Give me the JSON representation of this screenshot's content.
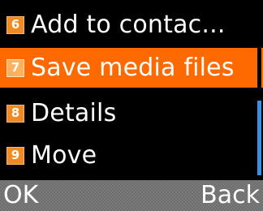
{
  "menu": {
    "items": [
      {
        "number": "6",
        "label": "Add to contac..."
      },
      {
        "number": "7",
        "label": "Save media files",
        "selected": true
      },
      {
        "number": "8",
        "label": "Details"
      },
      {
        "number": "9",
        "label": "Move"
      }
    ],
    "scroll_position": 0.75
  },
  "softkeys": {
    "left": "OK",
    "right": "Back"
  },
  "colors": {
    "background": "#000000",
    "selection": "#ff6a00",
    "number_badge": "#f08a24",
    "scrollbar": "#3b8fe0",
    "softkey_bar": "#6e6e6e",
    "text": "#ffffff"
  }
}
